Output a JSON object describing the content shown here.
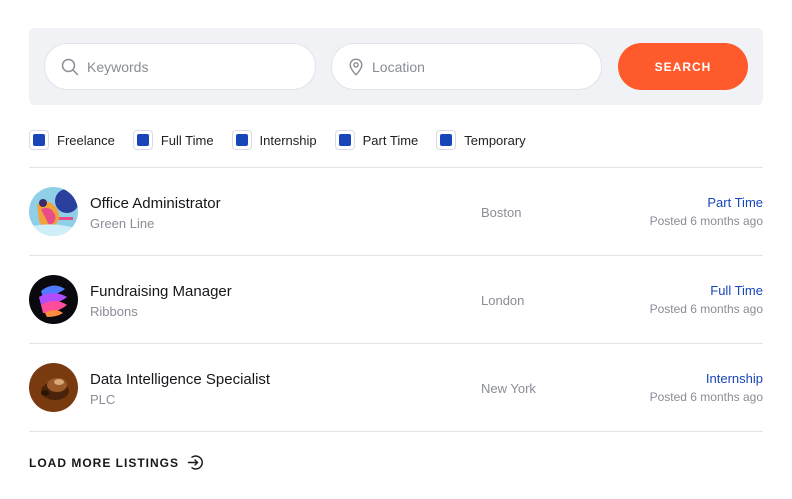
{
  "search": {
    "keywords_placeholder": "Keywords",
    "keywords_value": "",
    "location_placeholder": "Location",
    "location_value": "",
    "button_label": "SEARCH"
  },
  "filters": [
    {
      "label": "Freelance",
      "checked": true
    },
    {
      "label": "Full Time",
      "checked": true
    },
    {
      "label": "Internship",
      "checked": true
    },
    {
      "label": "Part Time",
      "checked": true
    },
    {
      "label": "Temporary",
      "checked": true
    }
  ],
  "listings": [
    {
      "title": "Office Administrator",
      "company": "Green Line",
      "location": "Boston",
      "type": "Part Time",
      "posted": "Posted 6 months ago"
    },
    {
      "title": "Fundraising Manager",
      "company": "Ribbons",
      "location": "London",
      "type": "Full Time",
      "posted": "Posted 6 months ago"
    },
    {
      "title": "Data Intelligence Specialist",
      "company": "PLC",
      "location": "New York",
      "type": "Internship",
      "posted": "Posted 6 months ago"
    }
  ],
  "load_more_label": "LOAD MORE LISTINGS",
  "colors": {
    "accent": "#ff5a2c",
    "link": "#1846b8",
    "panel": "#f1f2f6"
  },
  "icons": {
    "keywords": "search-icon",
    "location": "map-pin-icon",
    "load_more": "arrow-right-circle-icon"
  }
}
